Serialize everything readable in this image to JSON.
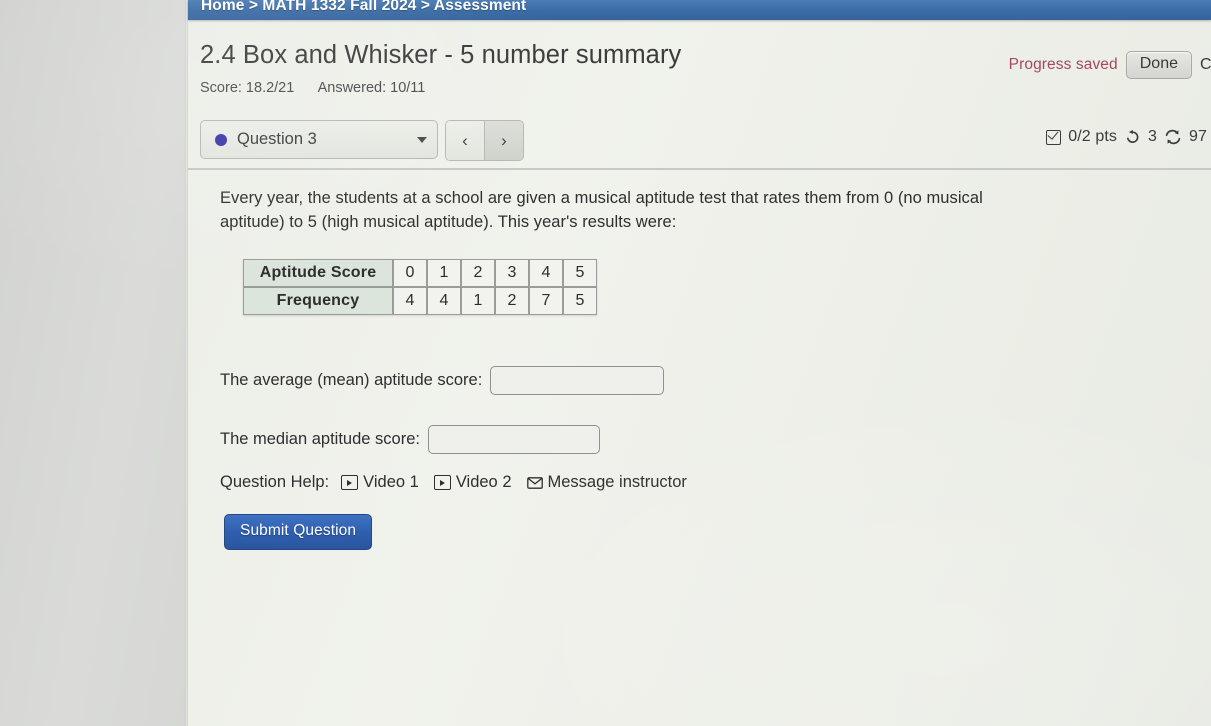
{
  "breadcrumb": {
    "text": "Home > MATH 1332 Fall 2024 > Assessment",
    "home": "Home",
    "course": "MATH 1332 Fall 2024",
    "section": "Assessment"
  },
  "header": {
    "title": "2.4 Box and Whisker - 5 number summary",
    "score_label": "Score: 18.2/21",
    "answered_label": "Answered: 10/11",
    "progress_saved": "Progress saved",
    "done_label": "Done",
    "clipped_right": "C"
  },
  "question_bar": {
    "selected_question": "Question 3",
    "status_dot_color": "#3b37a8",
    "caret_icon": "chevron-down-icon",
    "prev_label": "‹",
    "next_label": "›",
    "points": "0/2 pts",
    "attempts": "3",
    "retries_clipped": "97",
    "checkbox_icon": "checkbox-checked-icon",
    "undo_icon": "undo-arrow-icon",
    "cycle_icon": "cycle-arrows-icon"
  },
  "question": {
    "prompt": "Every year, the students at a school are given a musical aptitude test that rates them from 0 (no musical aptitude) to 5 (high musical aptitude). This year's results were:",
    "mean_label": "The average (mean) aptitude score:",
    "median_label": "The median aptitude score:",
    "mean_value": "",
    "median_value": "",
    "mean_placeholder": "",
    "median_placeholder": ""
  },
  "chart_data": {
    "type": "table",
    "title": "",
    "row_headers": [
      "Aptitude Score",
      "Frequency"
    ],
    "categories": [
      "0",
      "1",
      "2",
      "3",
      "4",
      "5"
    ],
    "values": [
      4,
      4,
      1,
      2,
      7,
      5
    ],
    "xlabel": "Aptitude Score",
    "ylabel": "Frequency",
    "rows": [
      {
        "header": "Aptitude Score",
        "cells": [
          "0",
          "1",
          "2",
          "3",
          "4",
          "5"
        ]
      },
      {
        "header": "Frequency",
        "cells": [
          "4",
          "4",
          "1",
          "2",
          "7",
          "5"
        ]
      }
    ]
  },
  "help": {
    "label": "Question Help:",
    "video1": "Video 1",
    "video2": "Video 2",
    "message_instructor": "Message instructor"
  },
  "actions": {
    "submit_label": "Submit Question"
  },
  "colors": {
    "breadcrumb_bar": "#3a6ba5",
    "submit_button": "#2f5fb0",
    "progress_saved_text": "#a34a60",
    "table_header_bg": "#dce5dc",
    "status_dot": "#3b37a8"
  }
}
